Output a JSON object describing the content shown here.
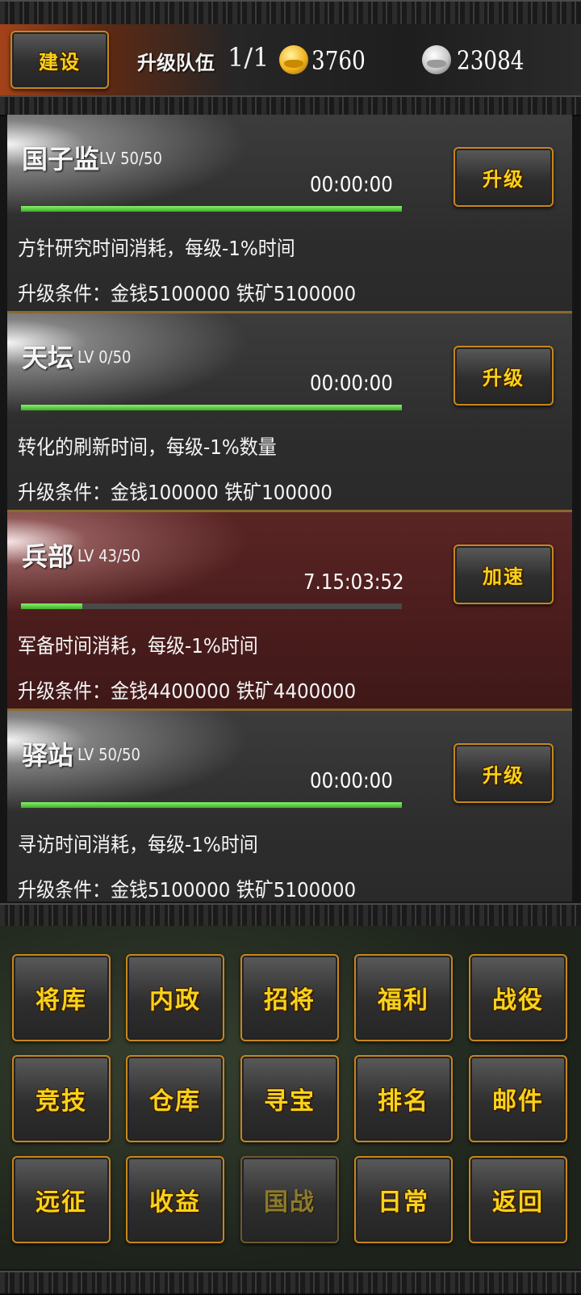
{
  "top_bar": {
    "build_label": "建设",
    "queue_label": "升级队伍",
    "queue_count": "1/1",
    "gold_icon": "gold-ingot-icon",
    "gold_value": "3760",
    "silver_icon": "silver-ingot-icon",
    "silver_value": "23084"
  },
  "buildings": [
    {
      "name": "国子监",
      "level": "LV 50/50",
      "timer": "00:00:00",
      "progress": 1.0,
      "description": "方针研究时间消耗，每级-1%时间",
      "condition": "升级条件：金钱5100000 铁矿5100000",
      "action": "升级"
    },
    {
      "name": "天坛",
      "level": "LV 0/50",
      "timer": "00:00:00",
      "progress": 1.0,
      "description": "转化的刷新时间，每级-1%数量",
      "condition": "升级条件：金钱100000 铁矿100000",
      "action": "升级"
    },
    {
      "name": "兵部",
      "level": "LV 43/50",
      "timer": "7.15:03:52",
      "progress": 0.16,
      "description": "军备时间消耗，每级-1%时间",
      "condition": "升级条件：金钱4400000 铁矿4400000",
      "action": "加速"
    },
    {
      "name": "驿站",
      "level": "LV 50/50",
      "timer": "00:00:00",
      "progress": 1.0,
      "description": "寻访时间消耗，每级-1%时间",
      "condition": "升级条件：金钱5100000 铁矿5100000",
      "action": "升级"
    }
  ],
  "menu": [
    {
      "label": "将库",
      "enabled": true
    },
    {
      "label": "内政",
      "enabled": true
    },
    {
      "label": "招将",
      "enabled": true
    },
    {
      "label": "福利",
      "enabled": true
    },
    {
      "label": "战役",
      "enabled": true
    },
    {
      "label": "竞技",
      "enabled": true
    },
    {
      "label": "仓库",
      "enabled": true
    },
    {
      "label": "寻宝",
      "enabled": true
    },
    {
      "label": "排名",
      "enabled": true
    },
    {
      "label": "邮件",
      "enabled": true
    },
    {
      "label": "远征",
      "enabled": true
    },
    {
      "label": "收益",
      "enabled": true
    },
    {
      "label": "国战",
      "enabled": false
    },
    {
      "label": "日常",
      "enabled": true
    },
    {
      "label": "返回",
      "enabled": true
    }
  ],
  "colors": {
    "button_text": "#f7d21a",
    "button_border": "#c8861c",
    "progress_green": "#6ad84a",
    "active_card": "#4a1c1c"
  }
}
